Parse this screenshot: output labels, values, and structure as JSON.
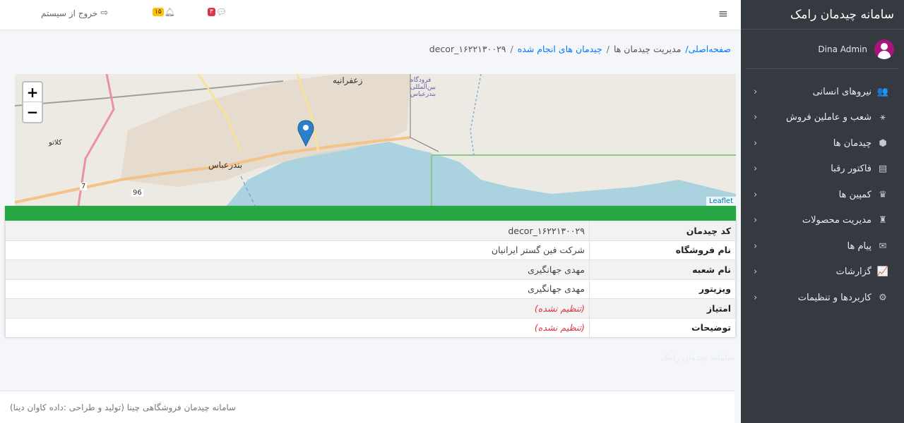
{
  "sidebar": {
    "brand": "سامانه چیدمان رامک",
    "user_name": "Dina Admin",
    "items": [
      {
        "label": "نیروهای انسانی",
        "icon": "users-icon",
        "glyph": "👥"
      },
      {
        "label": "شعب و عاملین فروش",
        "icon": "sitemap-icon",
        "glyph": "⚹"
      },
      {
        "label": "چیدمان ها",
        "icon": "cubes-icon",
        "glyph": "⬢"
      },
      {
        "label": "فاکتور رقبا",
        "icon": "book-icon",
        "glyph": "▤"
      },
      {
        "label": "کمپین ها",
        "icon": "campaign-icon",
        "glyph": "♛"
      },
      {
        "label": "مدیریت محصولات",
        "icon": "trophy-icon",
        "glyph": "♜"
      },
      {
        "label": "پیام ها",
        "icon": "comments-icon",
        "glyph": "✉"
      },
      {
        "label": "گزارشات",
        "icon": "chart-icon",
        "glyph": "📈"
      },
      {
        "label": "کاربردها و تنظیمات",
        "icon": "cogs-icon",
        "glyph": "⚙"
      }
    ]
  },
  "topbar": {
    "logout_label": "خروج از سیستم",
    "notifications_count": "۱۵",
    "messages_count": "۳"
  },
  "breadcrumb": {
    "home": "صفحه‌اصلی/",
    "section": "مدیریت چیدمان ها",
    "sep1": "/",
    "subsection": "چیدمان های انجام شده",
    "sep2": "/",
    "current": "decor_۱۶۲۲۱۳۰۰۲۹"
  },
  "map": {
    "attribution": "Leaflet",
    "zoom_in": "+",
    "zoom_out": "−",
    "labels": {
      "city": "بندرعباس",
      "district": "زعفرانیه",
      "village": "کلاتو",
      "road7": "7",
      "road96": "96",
      "airport": "فرودگاه بین‌المللی بندرعباس"
    }
  },
  "details": {
    "rows": [
      {
        "key": "کد چیدمان",
        "value": "decor_۱۶۲۲۱۳۰۰۲۹",
        "unset": false
      },
      {
        "key": "نام فروشگاه",
        "value": "شرکت فین گستر ایرانیان",
        "unset": false
      },
      {
        "key": "نام شعبه",
        "value": "مهدی جهانگیری",
        "unset": false
      },
      {
        "key": "ویزیتور",
        "value": "مهدی جهانگیری",
        "unset": false
      },
      {
        "key": "امتیاز",
        "value": "(تنظیم نشده)",
        "unset": true
      },
      {
        "key": "توضیحات",
        "value": "(تنظیم نشده)",
        "unset": true
      }
    ]
  },
  "watermark": "سامانه چیدمان رامک",
  "footer": {
    "text": "سامانه چیدمان فروشگاهی چینا (تولید و طراحی :داده کاوان دینا)"
  },
  "colors": {
    "sidebar_bg": "#343a40",
    "header_green": "#28a745",
    "link_blue": "#007bff",
    "unset_red": "#dc3545"
  }
}
